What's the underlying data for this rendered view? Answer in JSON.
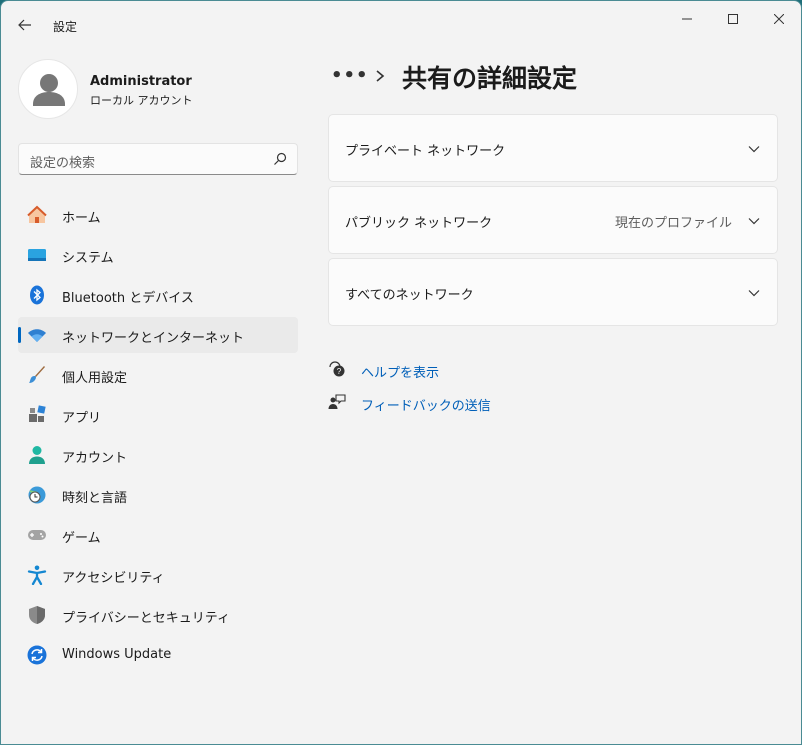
{
  "window": {
    "title": "設定"
  },
  "profile": {
    "name": "Administrator",
    "account_type": "ローカル アカウント"
  },
  "search": {
    "placeholder": "設定の検索"
  },
  "sidebar": {
    "items": [
      {
        "label": "ホーム",
        "icon": "home-icon"
      },
      {
        "label": "システム",
        "icon": "system-icon"
      },
      {
        "label": "Bluetooth とデバイス",
        "icon": "bluetooth-icon"
      },
      {
        "label": "ネットワークとインターネット",
        "icon": "wifi-icon",
        "active": true
      },
      {
        "label": "個人用設定",
        "icon": "brush-icon"
      },
      {
        "label": "アプリ",
        "icon": "apps-icon"
      },
      {
        "label": "アカウント",
        "icon": "account-icon"
      },
      {
        "label": "時刻と言語",
        "icon": "time-language-icon"
      },
      {
        "label": "ゲーム",
        "icon": "gamepad-icon"
      },
      {
        "label": "アクセシビリティ",
        "icon": "accessibility-icon"
      },
      {
        "label": "プライバシーとセキュリティ",
        "icon": "shield-icon"
      },
      {
        "label": "Windows Update",
        "icon": "update-icon"
      }
    ]
  },
  "breadcrumb": {
    "overflow": "•••",
    "title": "共有の詳細設定"
  },
  "sections": [
    {
      "label": "プライベート ネットワーク",
      "status": ""
    },
    {
      "label": "パブリック ネットワーク",
      "status": "現在のプロファイル"
    },
    {
      "label": "すべてのネットワーク",
      "status": ""
    }
  ],
  "links": {
    "help": "ヘルプを表示",
    "feedback": "フィードバックの送信"
  },
  "colors": {
    "accent": "#0067c0",
    "link": "#005fb8",
    "window_bg": "#f3f3f3"
  }
}
